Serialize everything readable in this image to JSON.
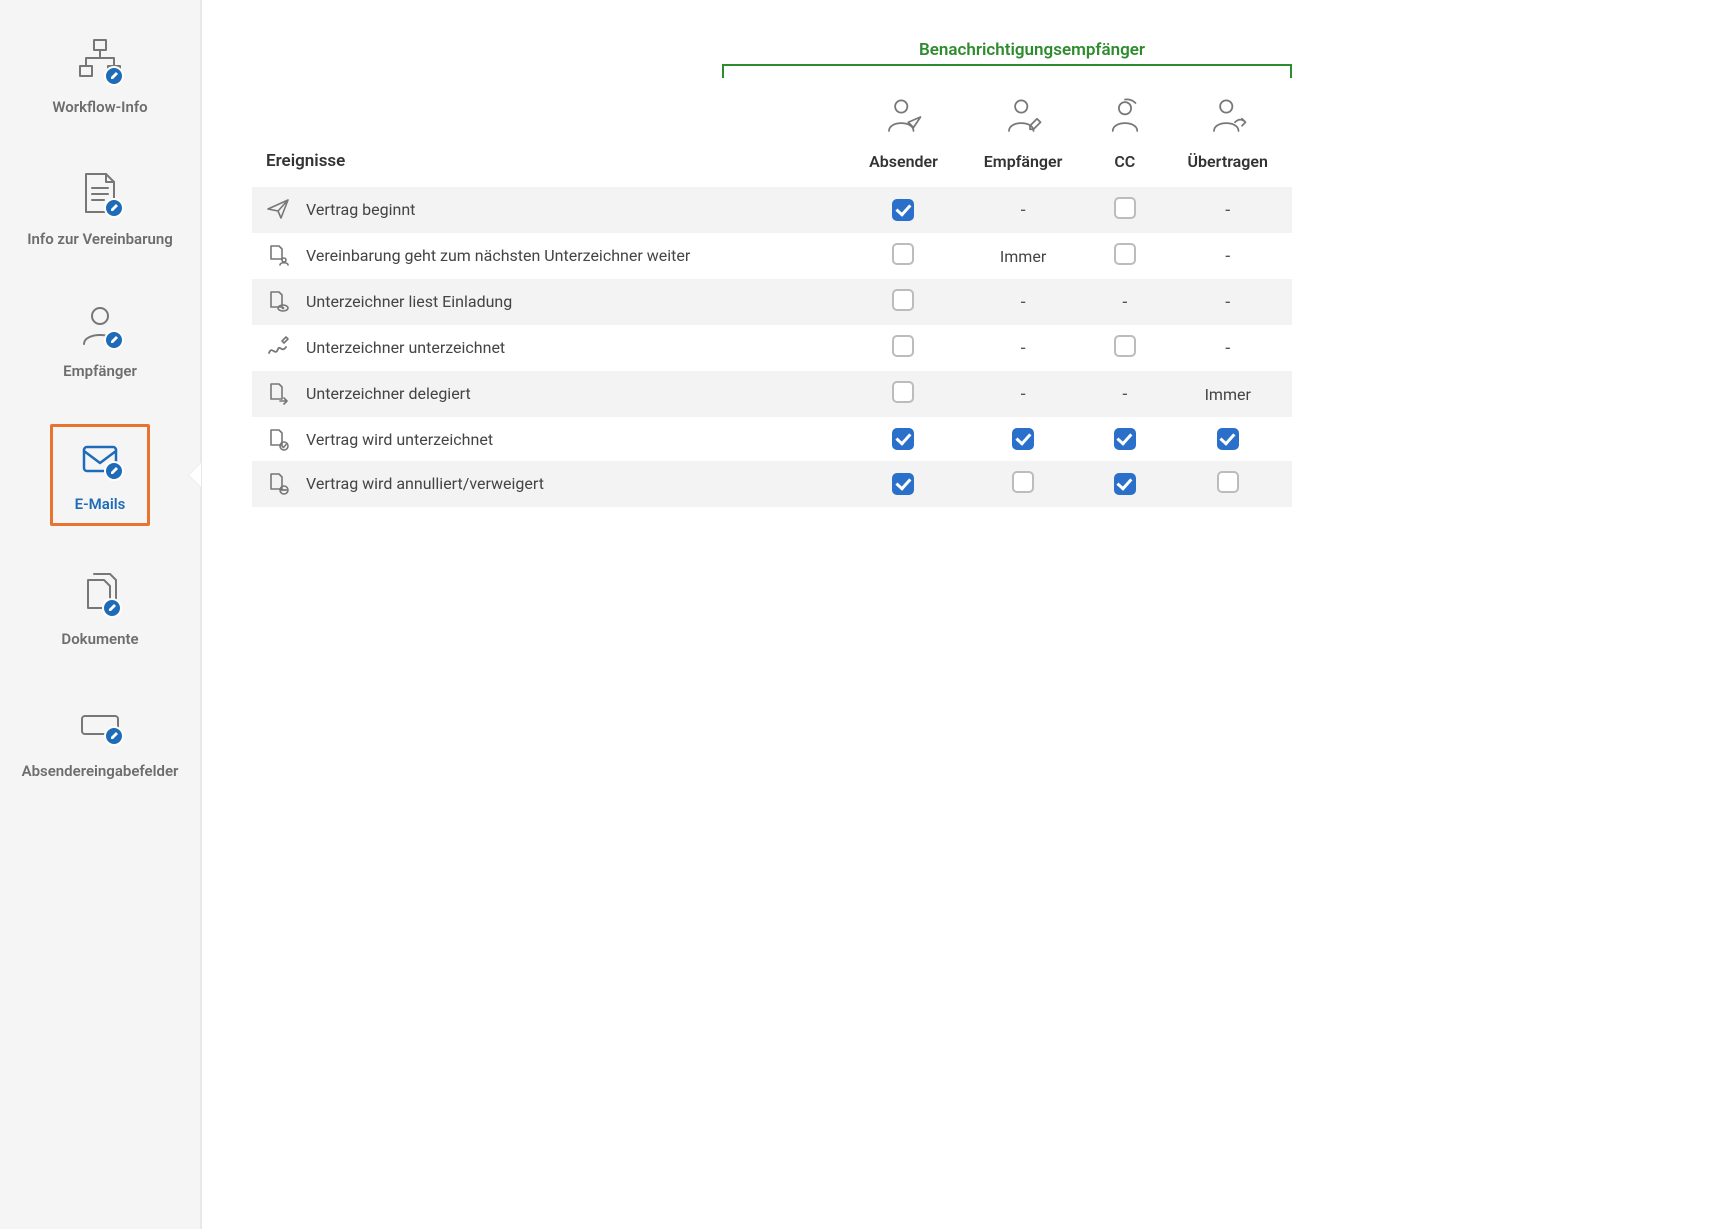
{
  "sidebar": {
    "items": [
      {
        "label": "Workflow-Info"
      },
      {
        "label": "Info zur Vereinbarung"
      },
      {
        "label": "Empfänger"
      },
      {
        "label": "E-Mails"
      },
      {
        "label": "Dokumente"
      },
      {
        "label": "Absendereingabefelder"
      }
    ]
  },
  "table": {
    "events_heading": "Ereignisse",
    "recipients_heading": "Benachrichtigungsempfänger",
    "columns": [
      {
        "label": "Absender"
      },
      {
        "label": "Empfänger"
      },
      {
        "label": "CC"
      },
      {
        "label": "Übertragen"
      }
    ],
    "rows": [
      {
        "label": "Vertrag beginnt",
        "cells": [
          {
            "type": "checkbox",
            "checked": true
          },
          {
            "type": "dash"
          },
          {
            "type": "checkbox",
            "checked": false
          },
          {
            "type": "dash"
          }
        ]
      },
      {
        "label": "Vereinbarung geht zum nächsten Unterzeichner weiter",
        "cells": [
          {
            "type": "checkbox",
            "checked": false
          },
          {
            "type": "text",
            "text": "Immer"
          },
          {
            "type": "checkbox",
            "checked": false
          },
          {
            "type": "dash"
          }
        ]
      },
      {
        "label": "Unterzeichner liest Einladung",
        "cells": [
          {
            "type": "checkbox",
            "checked": false
          },
          {
            "type": "dash"
          },
          {
            "type": "dash"
          },
          {
            "type": "dash"
          }
        ]
      },
      {
        "label": "Unterzeichner unterzeichnet",
        "cells": [
          {
            "type": "checkbox",
            "checked": false
          },
          {
            "type": "dash"
          },
          {
            "type": "checkbox",
            "checked": false
          },
          {
            "type": "dash"
          }
        ]
      },
      {
        "label": "Unterzeichner delegiert",
        "cells": [
          {
            "type": "checkbox",
            "checked": false
          },
          {
            "type": "dash"
          },
          {
            "type": "dash"
          },
          {
            "type": "text",
            "text": "Immer"
          }
        ]
      },
      {
        "label": "Vertrag wird unterzeichnet",
        "cells": [
          {
            "type": "checkbox",
            "checked": true
          },
          {
            "type": "checkbox",
            "checked": true
          },
          {
            "type": "checkbox",
            "checked": true
          },
          {
            "type": "checkbox",
            "checked": true
          }
        ]
      },
      {
        "label": "Vertrag wird annulliert/verweigert",
        "cells": [
          {
            "type": "checkbox",
            "checked": true
          },
          {
            "type": "checkbox",
            "checked": false
          },
          {
            "type": "checkbox",
            "checked": true
          },
          {
            "type": "checkbox",
            "checked": false
          }
        ]
      }
    ]
  }
}
